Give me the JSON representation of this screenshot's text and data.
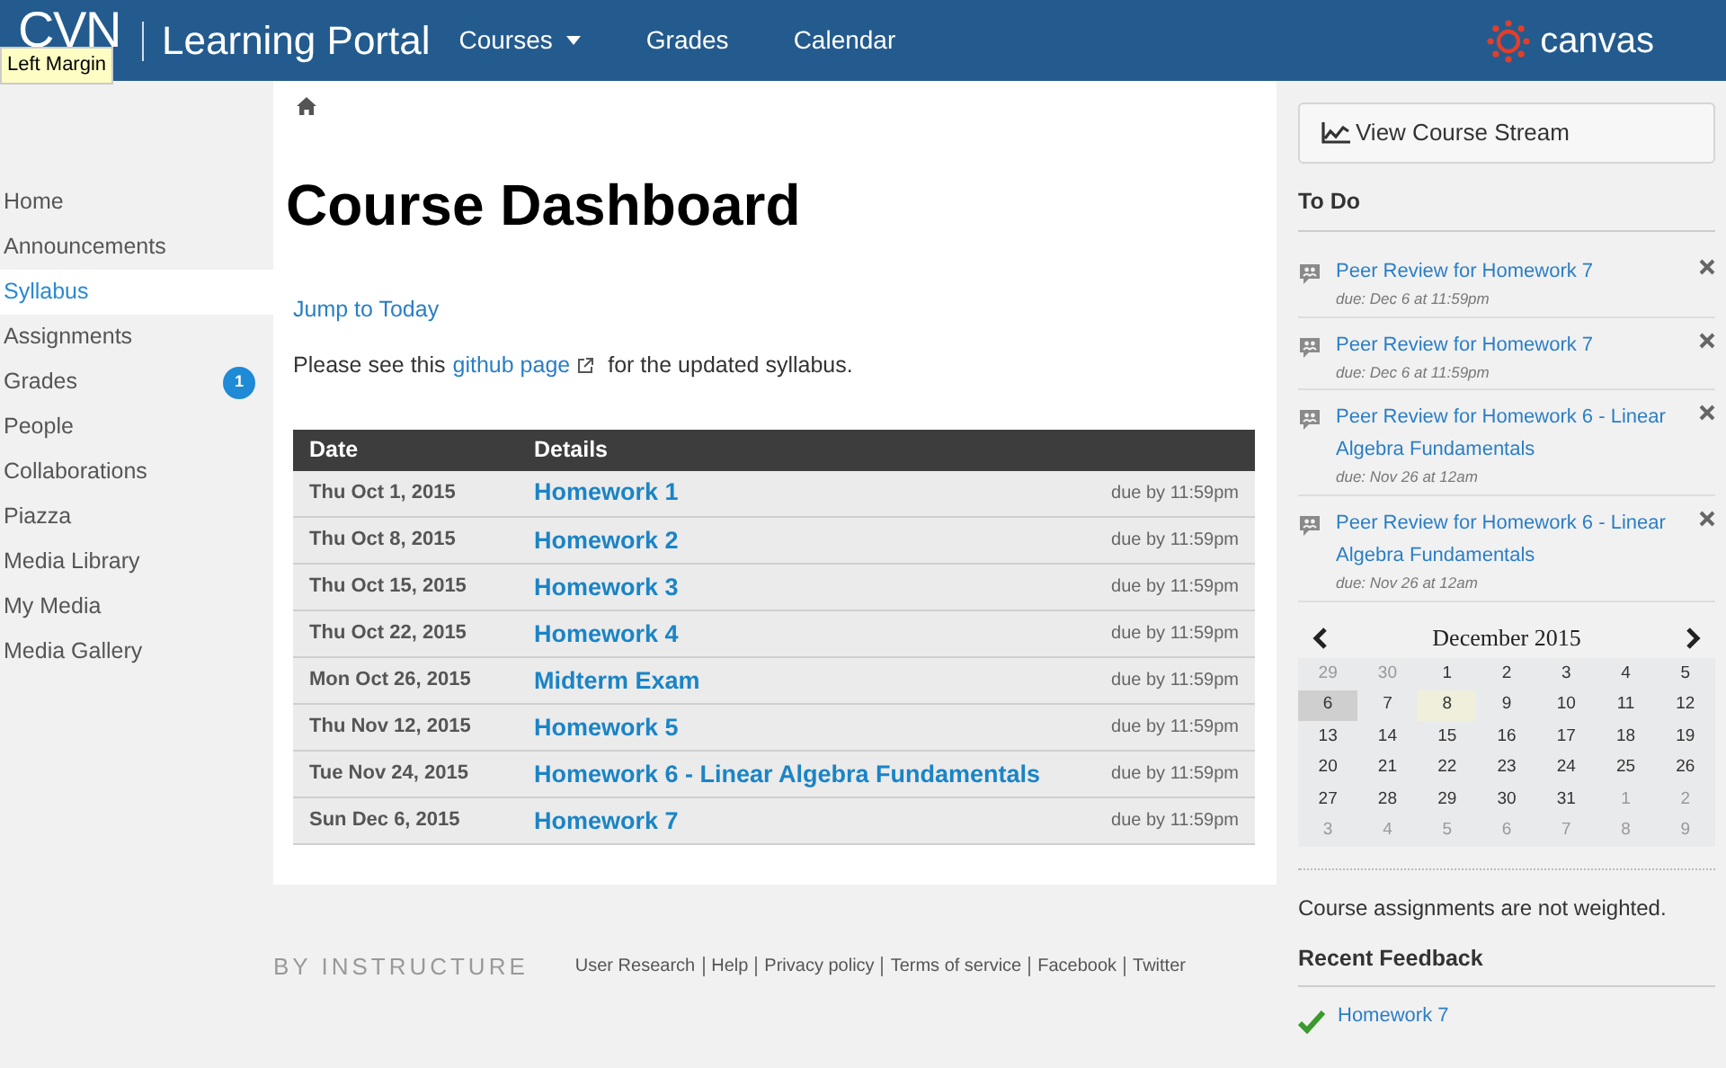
{
  "header": {
    "logo": "CVN",
    "portal": "Learning Portal",
    "nav": [
      {
        "label": "Courses",
        "dropdown": true
      },
      {
        "label": "Grades",
        "dropdown": false
      },
      {
        "label": "Calendar",
        "dropdown": false
      }
    ],
    "brand": "canvas"
  },
  "tooltip": "Left Margin",
  "sidebar": {
    "items": [
      {
        "label": "Home",
        "selected": false
      },
      {
        "label": "Announcements",
        "selected": false
      },
      {
        "label": "Syllabus",
        "selected": true
      },
      {
        "label": "Assignments",
        "selected": false
      },
      {
        "label": "Grades",
        "selected": false,
        "badge": "1"
      },
      {
        "label": "People",
        "selected": false
      },
      {
        "label": "Collaborations",
        "selected": false
      },
      {
        "label": "Piazza",
        "selected": false
      },
      {
        "label": "Media Library",
        "selected": false
      },
      {
        "label": "My Media",
        "selected": false
      },
      {
        "label": "Media Gallery",
        "selected": false
      }
    ]
  },
  "main": {
    "title": "Course Dashboard",
    "jump": "Jump to Today",
    "note_before": "Please see this",
    "note_link": "github page",
    "note_after": "for the updated syllabus.",
    "table": {
      "columns": [
        "Date",
        "Details"
      ],
      "rows": [
        {
          "date": "Thu Oct 1, 2015",
          "title": "Homework 1",
          "due": "due by 11:59pm"
        },
        {
          "date": "Thu Oct 8, 2015",
          "title": "Homework 2",
          "due": "due by 11:59pm"
        },
        {
          "date": "Thu Oct 15, 2015",
          "title": "Homework 3",
          "due": "due by 11:59pm"
        },
        {
          "date": "Thu Oct 22, 2015",
          "title": "Homework 4",
          "due": "due by 11:59pm"
        },
        {
          "date": "Mon Oct 26, 2015",
          "title": "Midterm Exam",
          "due": "due by 11:59pm"
        },
        {
          "date": "Thu Nov 12, 2015",
          "title": "Homework 5",
          "due": "due by 11:59pm"
        },
        {
          "date": "Tue Nov 24, 2015",
          "title": "Homework 6 - Linear Algebra Fundamentals",
          "due": "due by 11:59pm"
        },
        {
          "date": "Sun Dec 6, 2015",
          "title": "Homework 7",
          "due": "due by 11:59pm"
        }
      ]
    }
  },
  "footer": {
    "brand": "BY INSTRUCTURE",
    "links": [
      "User Research",
      "Help",
      "Privacy policy",
      "Terms of service",
      "Facebook",
      "Twitter"
    ]
  },
  "right": {
    "stream_button": "View Course Stream",
    "todo_title": "To Do",
    "todo": [
      {
        "title": "Peer Review for Homework 7",
        "due": "due: Dec 6 at 11:59pm"
      },
      {
        "title": "Peer Review for Homework 7",
        "due": "due: Dec 6 at 11:59pm"
      },
      {
        "title": "Peer Review for Homework 6 - Linear Algebra Fundamentals",
        "due": "due: Nov 26 at 12am"
      },
      {
        "title": "Peer Review for Homework 6 - Linear Algebra Fundamentals",
        "due": "due: Nov 26 at 12am"
      }
    ],
    "calendar": {
      "month": "December 2015",
      "days": [
        {
          "day": "29",
          "other": true,
          "selected": false,
          "today": false
        },
        {
          "day": "30",
          "other": true,
          "selected": false,
          "today": false
        },
        {
          "day": "1",
          "other": false,
          "selected": false,
          "today": false
        },
        {
          "day": "2",
          "other": false,
          "selected": false,
          "today": false
        },
        {
          "day": "3",
          "other": false,
          "selected": false,
          "today": false
        },
        {
          "day": "4",
          "other": false,
          "selected": false,
          "today": false
        },
        {
          "day": "5",
          "other": false,
          "selected": false,
          "today": false
        },
        {
          "day": "6",
          "other": false,
          "selected": true,
          "today": false
        },
        {
          "day": "7",
          "other": false,
          "selected": false,
          "today": false
        },
        {
          "day": "8",
          "other": false,
          "selected": false,
          "today": true
        },
        {
          "day": "9",
          "other": false,
          "selected": false,
          "today": false
        },
        {
          "day": "10",
          "other": false,
          "selected": false,
          "today": false
        },
        {
          "day": "11",
          "other": false,
          "selected": false,
          "today": false
        },
        {
          "day": "12",
          "other": false,
          "selected": false,
          "today": false
        },
        {
          "day": "13",
          "other": false,
          "selected": false,
          "today": false
        },
        {
          "day": "14",
          "other": false,
          "selected": false,
          "today": false
        },
        {
          "day": "15",
          "other": false,
          "selected": false,
          "today": false
        },
        {
          "day": "16",
          "other": false,
          "selected": false,
          "today": false
        },
        {
          "day": "17",
          "other": false,
          "selected": false,
          "today": false
        },
        {
          "day": "18",
          "other": false,
          "selected": false,
          "today": false
        },
        {
          "day": "19",
          "other": false,
          "selected": false,
          "today": false
        },
        {
          "day": "20",
          "other": false,
          "selected": false,
          "today": false
        },
        {
          "day": "21",
          "other": false,
          "selected": false,
          "today": false
        },
        {
          "day": "22",
          "other": false,
          "selected": false,
          "today": false
        },
        {
          "day": "23",
          "other": false,
          "selected": false,
          "today": false
        },
        {
          "day": "24",
          "other": false,
          "selected": false,
          "today": false
        },
        {
          "day": "25",
          "other": false,
          "selected": false,
          "today": false
        },
        {
          "day": "26",
          "other": false,
          "selected": false,
          "today": false
        },
        {
          "day": "27",
          "other": false,
          "selected": false,
          "today": false
        },
        {
          "day": "28",
          "other": false,
          "selected": false,
          "today": false
        },
        {
          "day": "29",
          "other": false,
          "selected": false,
          "today": false
        },
        {
          "day": "30",
          "other": false,
          "selected": false,
          "today": false
        },
        {
          "day": "31",
          "other": false,
          "selected": false,
          "today": false
        },
        {
          "day": "1",
          "other": true,
          "selected": false,
          "today": false
        },
        {
          "day": "2",
          "other": true,
          "selected": false,
          "today": false
        },
        {
          "day": "3",
          "other": true,
          "selected": false,
          "today": false
        },
        {
          "day": "4",
          "other": true,
          "selected": false,
          "today": false
        },
        {
          "day": "5",
          "other": true,
          "selected": false,
          "today": false
        },
        {
          "day": "6",
          "other": true,
          "selected": false,
          "today": false
        },
        {
          "day": "7",
          "other": true,
          "selected": false,
          "today": false
        },
        {
          "day": "8",
          "other": true,
          "selected": false,
          "today": false
        },
        {
          "day": "9",
          "other": true,
          "selected": false,
          "today": false
        }
      ]
    },
    "weight_note": "Course assignments are not weighted.",
    "feedback_title": "Recent Feedback",
    "feedback": [
      {
        "title": "Homework 7"
      }
    ]
  }
}
